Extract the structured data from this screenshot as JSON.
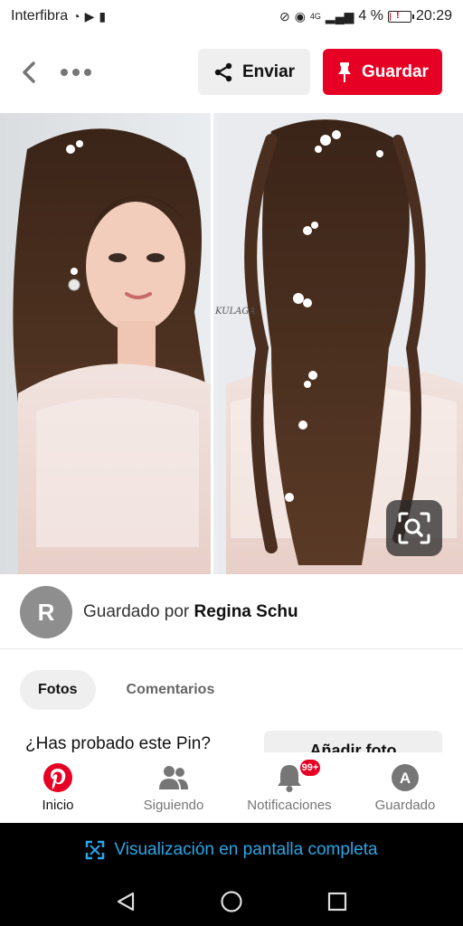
{
  "status_bar": {
    "carrier": "Interfibra",
    "network": "4G",
    "battery": "4 %",
    "battery_level": 0.04,
    "time": "20:29"
  },
  "top_bar": {
    "send_label": "Enviar",
    "save_label": "Guardar",
    "icons": [
      "chevron-left-icon",
      "more-dots-icon",
      "share-icon",
      "pin-icon"
    ]
  },
  "pin": {
    "watermark": "KULAGA",
    "lens_icon": "visual-search-icon"
  },
  "saved_by": {
    "avatar_letter": "R",
    "prefix": "Guardado por",
    "name": "Regina Schu"
  },
  "tabs": [
    {
      "label": "Fotos",
      "active": true
    },
    {
      "label": "Comentarios",
      "active": false
    }
  ],
  "tried": {
    "title": "¿Has probado este Pin?",
    "button_label": "Añadir foto"
  },
  "bottom_nav": {
    "items": [
      {
        "label": "Inicio",
        "icon": "pinterest-logo-icon",
        "active": true
      },
      {
        "label": "Siguiendo",
        "icon": "people-icon",
        "active": false
      },
      {
        "label": "Notificaciones",
        "icon": "bell-icon",
        "active": false,
        "badge": "99+"
      },
      {
        "label": "Guardado",
        "icon": "profile-avatar-icon",
        "active": false,
        "avatar_letter": "A"
      }
    ]
  },
  "fullscreen_banner": {
    "label": "Visualización en pantalla completa",
    "icon": "fullscreen-icon"
  },
  "colors": {
    "brand_red": "#e60023",
    "banner_blue": "#29a7e8"
  }
}
